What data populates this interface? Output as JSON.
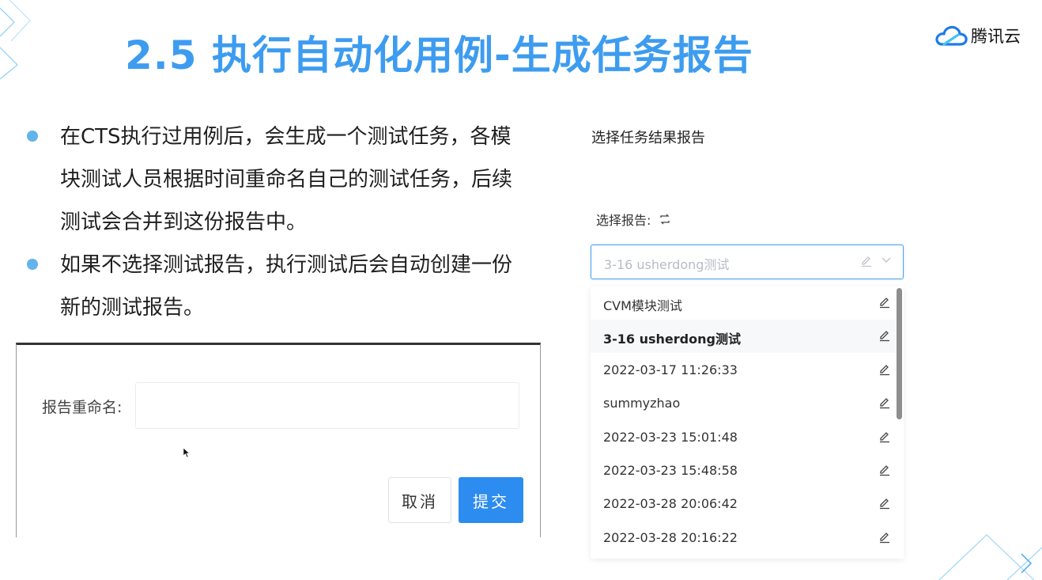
{
  "slide": {
    "title": "2.5 执行自动化用例-生成任务报告",
    "brand": {
      "name": "腾讯云",
      "icon": "cloud-logo-icon",
      "colors": [
        "#1e7be8",
        "#45c3f2"
      ]
    },
    "accent_color": "#3d9cf0",
    "bullet_color": "#63b3ec",
    "bullets": [
      "在CTS执行过用例后，会生成一个测试任务，各模块测试人员根据时间重命名自己的测试任务，后续测试会合并到这份报告中。",
      "如果不选择测试报告，执行测试后会自动创建一份新的测试报告。"
    ]
  },
  "rename_dialog": {
    "label": "报告重命名:",
    "input_value": "",
    "cancel_label": "取消",
    "submit_label": "提交",
    "submit_color": "#2d8cf0"
  },
  "report_selector": {
    "panel_title": "选择任务结果报告",
    "select_label": "选择报告:",
    "refresh_icon": "refresh-icon",
    "selected_placeholder": "3-16 usherdong测试",
    "focus_color": "#4aa0f0",
    "options": [
      {
        "label": "CVM模块测试",
        "highlighted": false
      },
      {
        "label": "3-16 usherdong测试",
        "highlighted": true
      },
      {
        "label": "2022-03-17 11:26:33",
        "highlighted": false
      },
      {
        "label": "summyzhao",
        "highlighted": false
      },
      {
        "label": "2022-03-23 15:01:48",
        "highlighted": false
      },
      {
        "label": "2022-03-23 15:48:58",
        "highlighted": false
      },
      {
        "label": "2022-03-28 20:06:42",
        "highlighted": false
      },
      {
        "label": "2022-03-28 20:16:22",
        "highlighted": false
      }
    ]
  }
}
